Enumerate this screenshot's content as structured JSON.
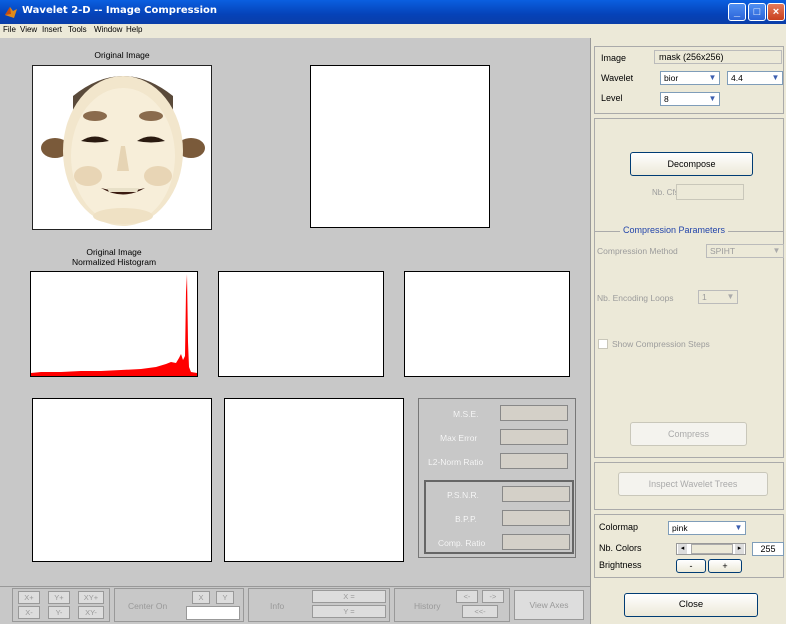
{
  "window": {
    "title": "Wavelet 2-D -- Image Compression"
  },
  "menu": [
    "File",
    "View",
    "Insert",
    "Tools",
    "Window",
    "Help"
  ],
  "plots": {
    "original_title": "Original Image",
    "histogram_title_1": "Original Image",
    "histogram_title_2": "Normalized Histogram"
  },
  "stats": {
    "mse": "M.S.E.",
    "max_error": "Max Error",
    "l2_norm_ratio": "L2-Norm Ratio",
    "psnr": "P.S.N.R.",
    "bpp": "B.P.P.",
    "comp_ratio": "Comp. Ratio"
  },
  "toolbar": {
    "xplus": "X+",
    "yplus": "Y+",
    "xyplus": "XY+",
    "xminus": "X-",
    "yminus": "Y-",
    "xyminus": "XY-",
    "center_on": "Center On",
    "x": "X",
    "y": "Y",
    "info": "Info",
    "x_eq": "X =",
    "y_eq": "Y =",
    "history": "History",
    "hist_back": "<-",
    "hist_fwd": "->",
    "hist_both": "<<-",
    "view_axes": "View Axes"
  },
  "controls": {
    "image_label": "Image",
    "image_value": "mask  (256x256)",
    "wavelet_label": "Wavelet",
    "wavelet_family": "bior",
    "wavelet_number": "4.4",
    "level_label": "Level",
    "level_value": "8",
    "decompose": "Decompose",
    "nb_cfs": "Nb. Cfs",
    "compression_params": "Compression Parameters",
    "compression_method_label": "Compression Method",
    "compression_method_value": "SPIHT",
    "encoding_loops_label": "Nb. Encoding Loops",
    "encoding_loops_value": "1",
    "show_steps": "Show Compression Steps",
    "compress": "Compress",
    "inspect_trees": "Inspect Wavelet Trees",
    "colormap_label": "Colormap",
    "colormap_value": "pink",
    "nb_colors_label": "Nb. Colors",
    "nb_colors_value": "255",
    "brightness_label": "Brightness",
    "bright_minus": "-",
    "bright_plus": "+",
    "close": "Close"
  },
  "histogram": {
    "color": "#ff0000"
  }
}
